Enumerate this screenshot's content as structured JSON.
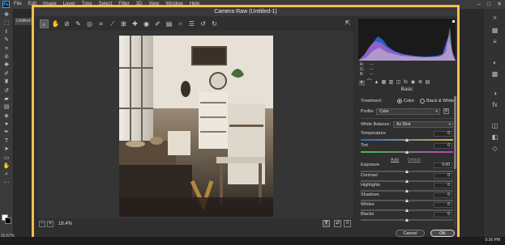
{
  "photoshop": {
    "logo": "Ps",
    "menu": [
      "File",
      "Edit",
      "Image",
      "Layer",
      "Type",
      "Select",
      "Filter",
      "3D",
      "View",
      "Window",
      "Help"
    ],
    "doc_tab": "Untitled-",
    "zoom_readout": "16.67%",
    "time": "9:36 PM"
  },
  "dialog": {
    "title": "Camera Raw (Untitled-1)",
    "zoom_level": "16.4%",
    "view_mode_label": "Y",
    "rgb": {
      "r_label": "R:",
      "g_label": "G:",
      "b_label": "B:",
      "r": "---",
      "g": "---",
      "b": "---"
    },
    "panel_title": "Basic",
    "treatment_label": "Treatment:",
    "treatment_options": [
      "Color",
      "Black & White"
    ],
    "treatment_selected": "Color",
    "profile_label": "Profile:",
    "profile_value": "Color",
    "white_balance_label": "White Balance:",
    "white_balance_value": "As Shot",
    "auto_label": "Auto",
    "default_label": "Default",
    "sliders": [
      {
        "label": "Temperature",
        "value": "0"
      },
      {
        "label": "Tint",
        "value": "0"
      },
      {
        "label": "Exposure",
        "value": "0.00"
      },
      {
        "label": "Contrast",
        "value": "0"
      },
      {
        "label": "Highlights",
        "value": "0"
      },
      {
        "label": "Shadows",
        "value": "0"
      },
      {
        "label": "Whites",
        "value": "0"
      },
      {
        "label": "Blacks",
        "value": "0"
      }
    ],
    "cancel_label": "Cancel",
    "ok_label": "OK"
  },
  "colors": {
    "dialog_border": "#f3bf52",
    "panel_bg": "#2f2f2f",
    "histogram_blue": "#2f6fe6",
    "histogram_magenta": "#d060d0"
  }
}
